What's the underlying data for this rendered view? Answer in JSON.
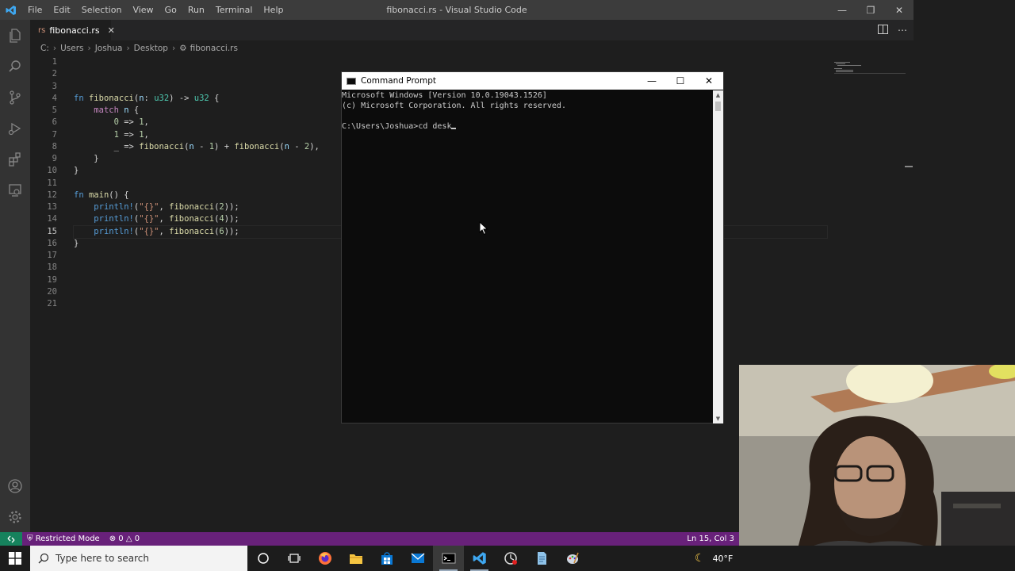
{
  "window": {
    "title": "fibonacci.rs - Visual Studio Code",
    "menu": [
      "File",
      "Edit",
      "Selection",
      "View",
      "Go",
      "Run",
      "Terminal",
      "Help"
    ]
  },
  "tab": {
    "label": "fibonacci.rs",
    "lang_badge": "rs"
  },
  "breadcrumb": [
    "C:",
    "Users",
    "Joshua",
    "Desktop",
    "fibonacci.rs"
  ],
  "editor": {
    "line_numbers": [
      "1",
      "2",
      "3",
      "4",
      "5",
      "6",
      "7",
      "8",
      "9",
      "10",
      "11",
      "12",
      "13",
      "14",
      "15",
      "16",
      "17",
      "18",
      "19",
      "20",
      "21"
    ],
    "active_line": 15
  },
  "statusbar": {
    "restricted": "Restricted Mode",
    "errors": "0",
    "warnings": "0",
    "position": "Ln 15, Col 3"
  },
  "cmd": {
    "title": "Command Prompt",
    "lines": [
      "Microsoft Windows [Version 10.0.19043.1526]",
      "(c) Microsoft Corporation. All rights reserved.",
      "",
      "C:\\Users\\Joshua>cd desk"
    ]
  },
  "taskbar": {
    "search_placeholder": "Type here to search",
    "temperature": "40°F"
  },
  "colors": {
    "statusbar": "#68217a",
    "remote": "#16825d",
    "editor_bg": "#1e1e1e"
  }
}
